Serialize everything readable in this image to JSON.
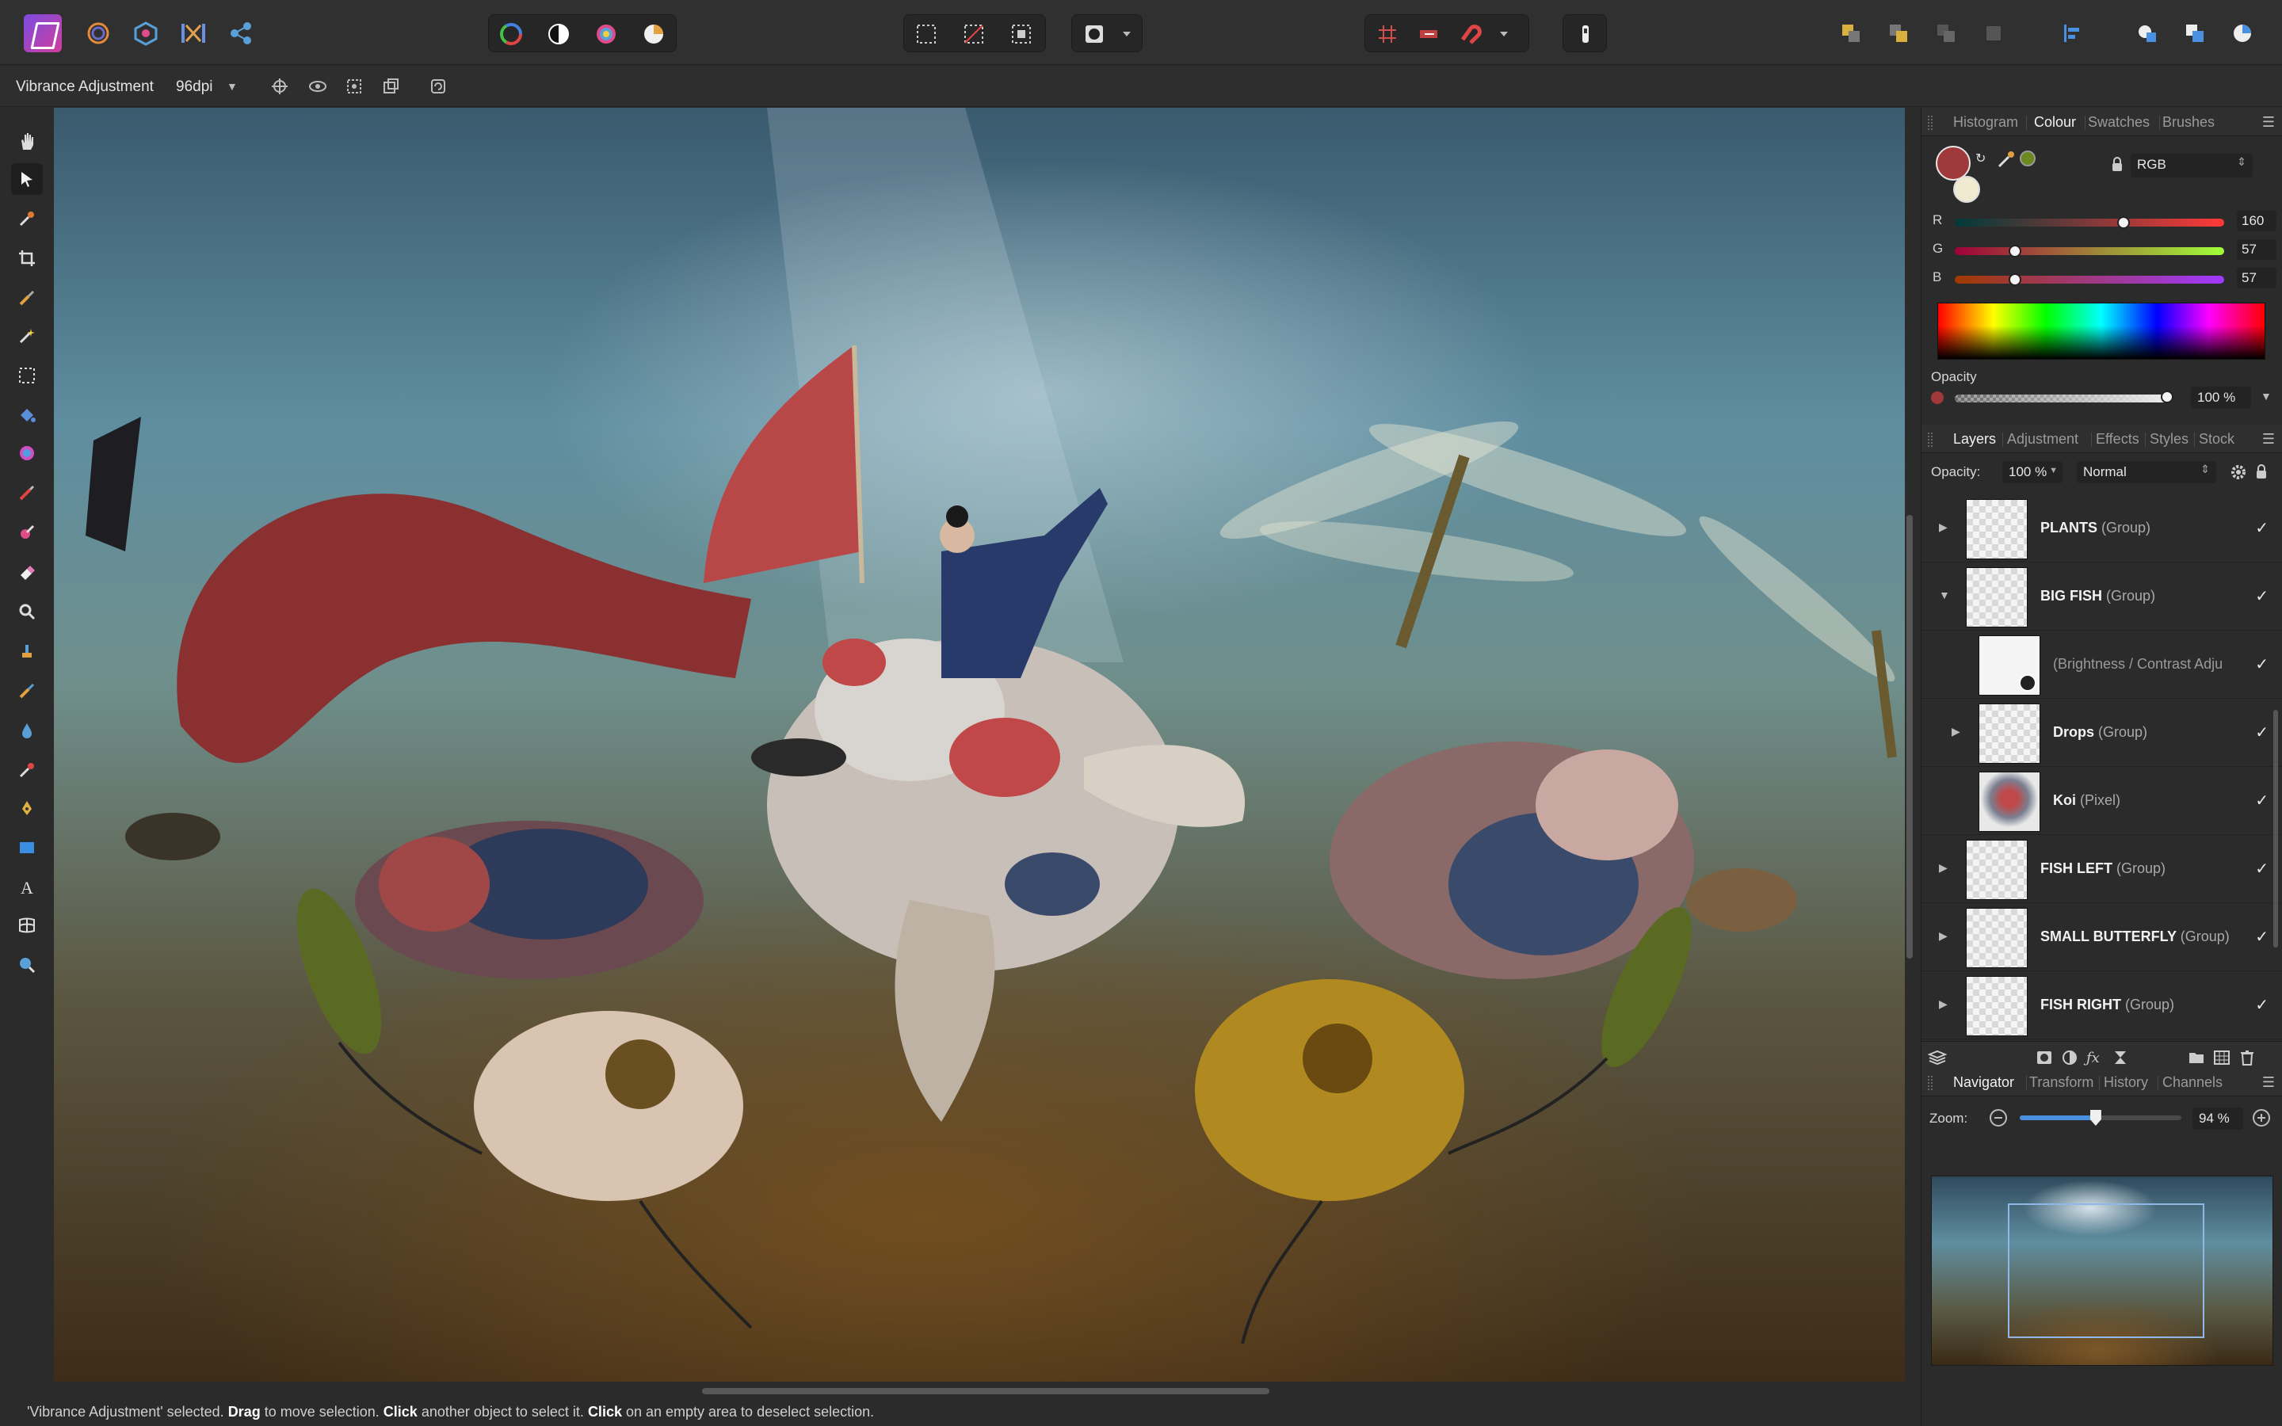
{
  "app": {
    "name": "Affinity Photo"
  },
  "context_bar": {
    "selection_title": "Vibrance Adjustment",
    "dpi": "96dpi"
  },
  "status_bar": {
    "part1": "'Vibrance Adjustment' selected. ",
    "drag": "Drag",
    "part2": " to move selection. ",
    "click1": "Click",
    "part3": " another object to select it. ",
    "click2": "Click",
    "part4": " on an empty area to deselect selection."
  },
  "colour_panel": {
    "tabs": [
      "Histogram",
      "Colour",
      "Swatches",
      "Brushes"
    ],
    "active_tab": "Colour",
    "model": "RGB",
    "channels": [
      {
        "label": "R",
        "value": "160",
        "fraction": 0.627
      },
      {
        "label": "G",
        "value": "57",
        "fraction": 0.224
      },
      {
        "label": "B",
        "value": "57",
        "fraction": 0.224
      }
    ],
    "primary_color": "#a03939",
    "opacity_label": "Opacity",
    "opacity_value": "100 %"
  },
  "layers_panel": {
    "tabs": [
      "Layers",
      "Adjustment",
      "Effects",
      "Styles",
      "Stock"
    ],
    "active_tab": "Layers",
    "opacity_label": "Opacity:",
    "opacity_value": "100 %",
    "blend_mode": "Normal",
    "layers": [
      {
        "name": "PLANTS",
        "kind": "(Group)",
        "expanded": false,
        "indent": 0,
        "checked": true
      },
      {
        "name": "BIG FISH",
        "kind": "(Group)",
        "expanded": true,
        "indent": 0,
        "checked": true
      },
      {
        "name": "(Brightness / Contrast Adju",
        "kind": "",
        "adjustment": true,
        "indent": 1,
        "checked": true
      },
      {
        "name": "Drops",
        "kind": "(Group)",
        "expanded": false,
        "indent": 1,
        "checked": true
      },
      {
        "name": "Koi",
        "kind": "(Pixel)",
        "indent": 1,
        "checked": true
      },
      {
        "name": "FISH LEFT",
        "kind": "(Group)",
        "expanded": false,
        "indent": 0,
        "checked": true
      },
      {
        "name": "SMALL BUTTERFLY",
        "kind": "(Group)",
        "expanded": false,
        "indent": 0,
        "checked": true
      },
      {
        "name": "FISH RIGHT",
        "kind": "(Group)",
        "expanded": false,
        "indent": 0,
        "checked": true
      }
    ]
  },
  "navigator_panel": {
    "tabs": [
      "Navigator",
      "Transform",
      "History",
      "Channels"
    ],
    "active_tab": "Navigator",
    "zoom_label": "Zoom:",
    "zoom_value": "94 %",
    "zoom_fraction": 0.47
  },
  "icons": {
    "top_personas": [
      "photo-persona-icon",
      "liquify-persona-icon",
      "develop-persona-icon",
      "tone-mapping-persona-icon",
      "export-persona-icon"
    ],
    "top_adjust": [
      "colour-wheel-icon",
      "contrast-icon",
      "saturation-icon",
      "white-balance-icon"
    ],
    "top_selection": [
      "select-all-icon",
      "deselect-icon",
      "invert-selection-icon"
    ],
    "top_misc": [
      "quick-mask-icon",
      "snapping-grid-icon",
      "force-pixel-align-icon",
      "snapping-magnet-icon",
      "assistant-icon"
    ],
    "top_arrange": [
      "arrange-back-icon",
      "arrange-forward-icon",
      "arrange-front-icon",
      "arrange-top-icon",
      "align-icon",
      "boolean-add-icon",
      "boolean-subtract-icon",
      "boolean-intersect-icon"
    ]
  }
}
